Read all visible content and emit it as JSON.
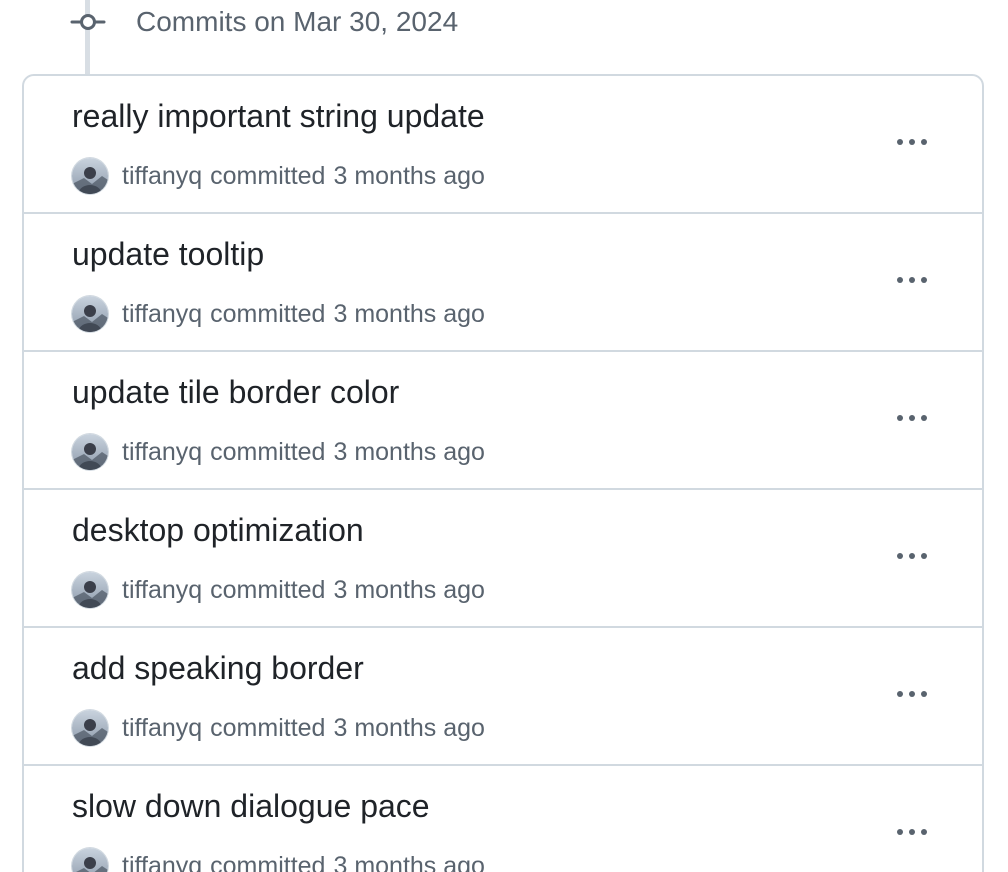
{
  "commit_group": {
    "title": "Commits on Mar 30, 2024",
    "icon": "git-commit-icon"
  },
  "commits": [
    {
      "message": "really important string update",
      "author": "tiffanyq",
      "action": "committed",
      "time": "3 months ago"
    },
    {
      "message": "update tooltip",
      "author": "tiffanyq",
      "action": "committed",
      "time": "3 months ago"
    },
    {
      "message": "update tile border color",
      "author": "tiffanyq",
      "action": "committed",
      "time": "3 months ago"
    },
    {
      "message": "desktop optimization",
      "author": "tiffanyq",
      "action": "committed",
      "time": "3 months ago"
    },
    {
      "message": "add speaking border",
      "author": "tiffanyq",
      "action": "committed",
      "time": "3 months ago"
    },
    {
      "message": "slow down dialogue pace",
      "author": "tiffanyq",
      "action": "committed",
      "time": "3 months ago"
    }
  ],
  "colors": {
    "text_primary": "#1f2328",
    "text_muted": "#59636e",
    "border": "#d1d9e0",
    "timeline": "#d8dee4"
  }
}
